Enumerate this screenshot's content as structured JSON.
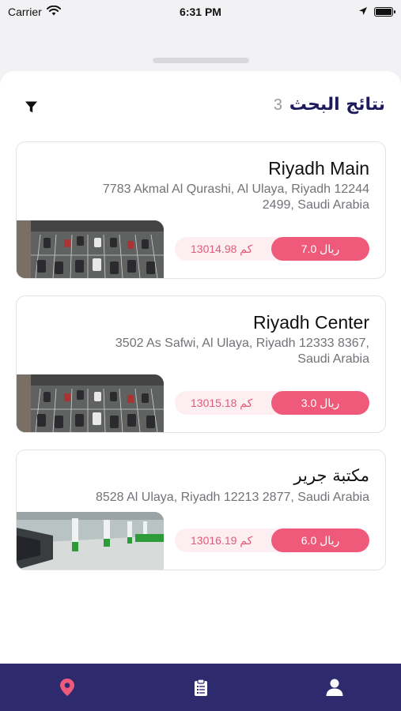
{
  "status_bar": {
    "carrier": "Carrier",
    "time": "6:31 PM"
  },
  "header": {
    "title": "نتائج البحث",
    "count": "3"
  },
  "results": [
    {
      "name": "Riyadh Main",
      "address": "7783 Akmal Al Qurashi, Al Ulaya, Riyadh 12244 2499, Saudi Arabia",
      "distance": "13014.98 كم",
      "price": "7.0 ريال",
      "image": "outdoor-parking-lot"
    },
    {
      "name": "Riyadh Center",
      "address": "3502 As Safwi, Al Ulaya, Riyadh 12333 8367, Saudi Arabia",
      "distance": "13015.18 كم",
      "price": "3.0 ريال",
      "image": "outdoor-parking-lot"
    },
    {
      "name": "مكتبة جرير",
      "address": "8528 Al Ulaya, Riyadh 12213 2877, Saudi Arabia",
      "distance": "13016.19 كم",
      "price": "6.0 ريال",
      "image": "indoor-parking-garage"
    }
  ],
  "tab_bar": {
    "tabs": [
      "map-pin-icon",
      "clipboard-list-icon",
      "user-icon"
    ],
    "active": "map-pin-icon"
  },
  "colors": {
    "accent": "#f05a7a",
    "title": "#1f1a5c",
    "tab_bar": "#2d2b6e"
  }
}
